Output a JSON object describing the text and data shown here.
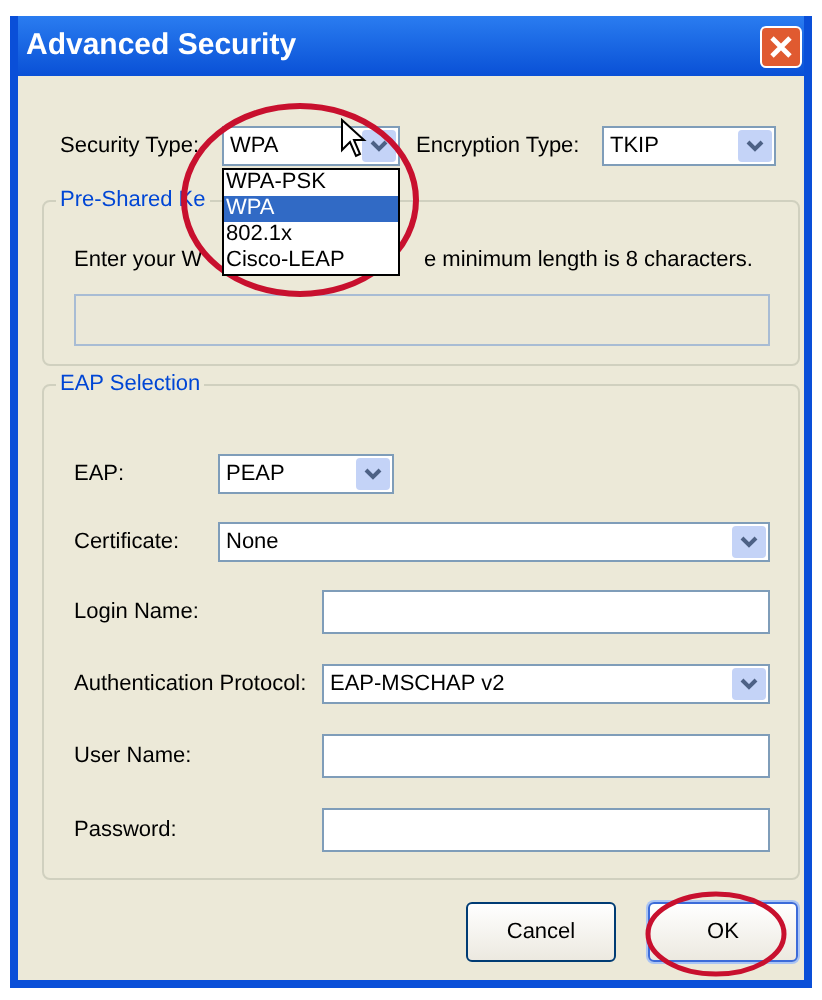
{
  "window": {
    "title": "Advanced Security"
  },
  "security_type": {
    "label": "Security Type:",
    "value": "WPA",
    "expanded": true,
    "options": [
      {
        "label": "WPA-PSK",
        "selected": false
      },
      {
        "label": "WPA",
        "selected": true
      },
      {
        "label": "802.1x",
        "selected": false
      },
      {
        "label": "Cisco-LEAP",
        "selected": false
      }
    ]
  },
  "encryption_type": {
    "label": "Encryption Type:",
    "value": "TKIP"
  },
  "pre_shared_key": {
    "legend": "Pre-Shared Ke",
    "hint_start": "Enter your W",
    "hint_end": "e minimum length is 8 characters.",
    "disabled": true
  },
  "eap_selection": {
    "legend": "EAP Selection",
    "fields": [
      {
        "kind": "select",
        "label": "EAP:",
        "value": "PEAP"
      },
      {
        "kind": "select",
        "label": "Certificate:",
        "value": "None"
      },
      {
        "kind": "input",
        "label": "Login Name:"
      },
      {
        "kind": "select",
        "label": "Authentication Protocol:",
        "value": "EAP-MSCHAP v2"
      },
      {
        "kind": "input",
        "label": "User Name:"
      },
      {
        "kind": "input",
        "label": "Password:"
      }
    ]
  },
  "buttons": [
    {
      "label": "Cancel",
      "default": false
    },
    {
      "label": "OK",
      "default": true
    }
  ]
}
